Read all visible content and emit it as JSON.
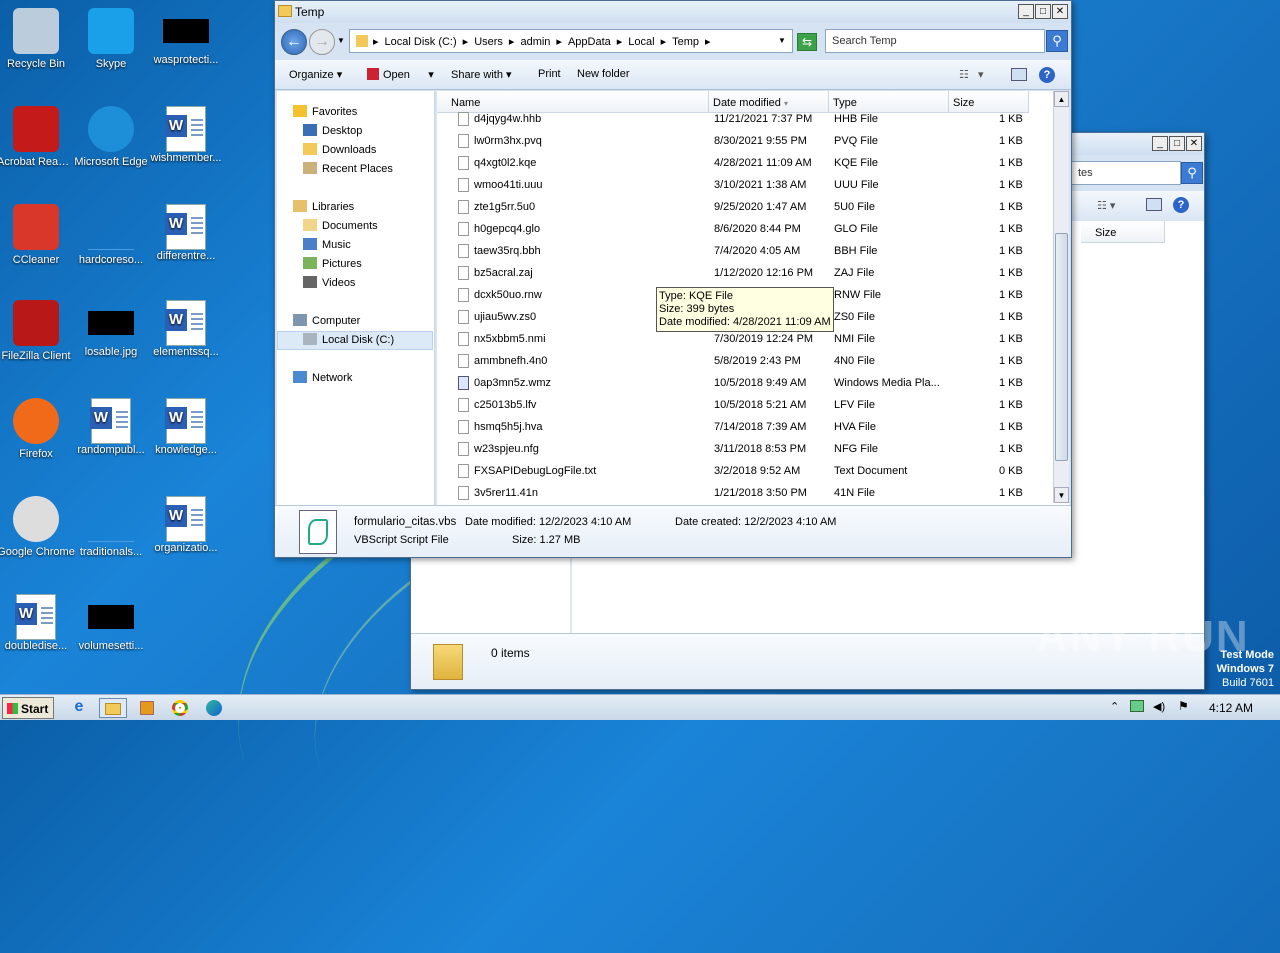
{
  "desktop": {
    "icons": [
      {
        "label": "Recycle Bin",
        "icon": "recycle-bin-icon"
      },
      {
        "label": "Skype",
        "icon": "skype-icon"
      },
      {
        "label": "wasprotecti...",
        "icon": "black-image-icon"
      },
      {
        "label": "Acrobat Reader DC",
        "icon": "acrobat-icon"
      },
      {
        "label": "Microsoft Edge",
        "icon": "edge-icon"
      },
      {
        "label": "wishmember...",
        "icon": "word-doc-icon"
      },
      {
        "label": "CCleaner",
        "icon": "ccleaner-icon"
      },
      {
        "label": "hardcoreso...",
        "icon": "blue-image-icon"
      },
      {
        "label": "differentre...",
        "icon": "word-doc-icon"
      },
      {
        "label": "FileZilla Client",
        "icon": "filezilla-icon"
      },
      {
        "label": "losable.jpg",
        "icon": "black-image-icon"
      },
      {
        "label": "elementssq...",
        "icon": "word-doc-icon"
      },
      {
        "label": "Firefox",
        "icon": "firefox-icon"
      },
      {
        "label": "randompubl...",
        "icon": "word-doc-icon"
      },
      {
        "label": "knowledge...",
        "icon": "word-doc-icon"
      },
      {
        "label": "Google Chrome",
        "icon": "chrome-icon"
      },
      {
        "label": "traditionals...",
        "icon": "blue-image-icon"
      },
      {
        "label": "organizatio...",
        "icon": "word-doc-icon"
      },
      {
        "label": "doubledise...",
        "icon": "word-doc-icon"
      },
      {
        "label": "volumesetti...",
        "icon": "black-image-icon"
      }
    ]
  },
  "explorer": {
    "title": "Temp",
    "breadcrumb": [
      "Local Disk (C:)",
      "Users",
      "admin",
      "AppData",
      "Local",
      "Temp"
    ],
    "search_placeholder": "Search Temp",
    "toolbar": {
      "organize": "Organize",
      "open": "Open",
      "share": "Share with",
      "print": "Print",
      "new_folder": "New folder"
    },
    "nav": {
      "favorites": "Favorites",
      "desktop": "Desktop",
      "downloads": "Downloads",
      "recent": "Recent Places",
      "libraries": "Libraries",
      "documents": "Documents",
      "music": "Music",
      "pictures": "Pictures",
      "videos": "Videos",
      "computer": "Computer",
      "local_disk": "Local Disk (C:)",
      "network": "Network"
    },
    "columns": {
      "name": "Name",
      "date": "Date modified",
      "type": "Type",
      "size": "Size"
    },
    "files": [
      {
        "name": "d4jqyg4w.hhb",
        "date": "11/21/2021 7:37 PM",
        "type": "HHB File",
        "size": "1 KB"
      },
      {
        "name": "lw0rm3hx.pvq",
        "date": "8/30/2021 9:55 PM",
        "type": "PVQ File",
        "size": "1 KB"
      },
      {
        "name": "q4xgt0l2.kqe",
        "date": "4/28/2021 11:09 AM",
        "type": "KQE File",
        "size": "1 KB"
      },
      {
        "name": "wmoo41ti.uuu",
        "date": "3/10/2021 1:38 AM",
        "type": "UUU File",
        "size": "1 KB"
      },
      {
        "name": "zte1g5rr.5u0",
        "date": "9/25/2020 1:47 AM",
        "type": "5U0 File",
        "size": "1 KB"
      },
      {
        "name": "h0gepcq4.glo",
        "date": "8/6/2020 8:44 PM",
        "type": "GLO File",
        "size": "1 KB"
      },
      {
        "name": "taew35rq.bbh",
        "date": "7/4/2020 4:05 AM",
        "type": "BBH File",
        "size": "1 KB"
      },
      {
        "name": "bz5acral.zaj",
        "date": "1/12/2020 12:16 PM",
        "type": "ZAJ File",
        "size": "1 KB"
      },
      {
        "name": "dcxk50uo.rnw",
        "date": "",
        "type": "RNW File",
        "size": "1 KB"
      },
      {
        "name": "ujiau5wv.zs0",
        "date": "",
        "type": "ZS0 File",
        "size": "1 KB"
      },
      {
        "name": "nx5xbbm5.nmi",
        "date": "7/30/2019 12:24 PM",
        "type": "NMI File",
        "size": "1 KB"
      },
      {
        "name": "ammbnefh.4n0",
        "date": "5/8/2019 2:43 PM",
        "type": "4N0 File",
        "size": "1 KB"
      },
      {
        "name": "0ap3mn5z.wmz",
        "date": "10/5/2018 9:49 AM",
        "type": "Windows Media Pla...",
        "size": "1 KB"
      },
      {
        "name": "c25013b5.lfv",
        "date": "10/5/2018 5:21 AM",
        "type": "LFV File",
        "size": "1 KB"
      },
      {
        "name": "hsmq5h5j.hva",
        "date": "7/14/2018 7:39 AM",
        "type": "HVA File",
        "size": "1 KB"
      },
      {
        "name": "w23spjeu.nfg",
        "date": "3/11/2018 8:53 PM",
        "type": "NFG File",
        "size": "1 KB"
      },
      {
        "name": "FXSAPIDebugLogFile.txt",
        "date": "3/2/2018 9:52 AM",
        "type": "Text Document",
        "size": "0 KB"
      },
      {
        "name": "3v5rer11.41n",
        "date": "1/21/2018 3:50 PM",
        "type": "41N File",
        "size": "1 KB"
      }
    ],
    "tooltip": {
      "l1": "Type: KQE File",
      "l2": "Size: 399 bytes",
      "l3": "Date modified: 4/28/2021 11:09 AM"
    },
    "details": {
      "name": "formulario_citas.vbs",
      "modified": "Date modified: 12/2/2023 4:10 AM",
      "created": "Date created: 12/2/2023 4:10 AM",
      "type": "VBScript Script File",
      "size": "Size: 1.27 MB"
    }
  },
  "bgwindow": {
    "search_fragment": "tes",
    "size_col": "Size",
    "items": "0 items"
  },
  "watermark": {
    "text": "ANY RUN",
    "test1": "Test Mode",
    "test2": "Windows 7",
    "test3": "Build 7601"
  },
  "taskbar": {
    "start": "Start",
    "clock": "4:12 AM"
  }
}
